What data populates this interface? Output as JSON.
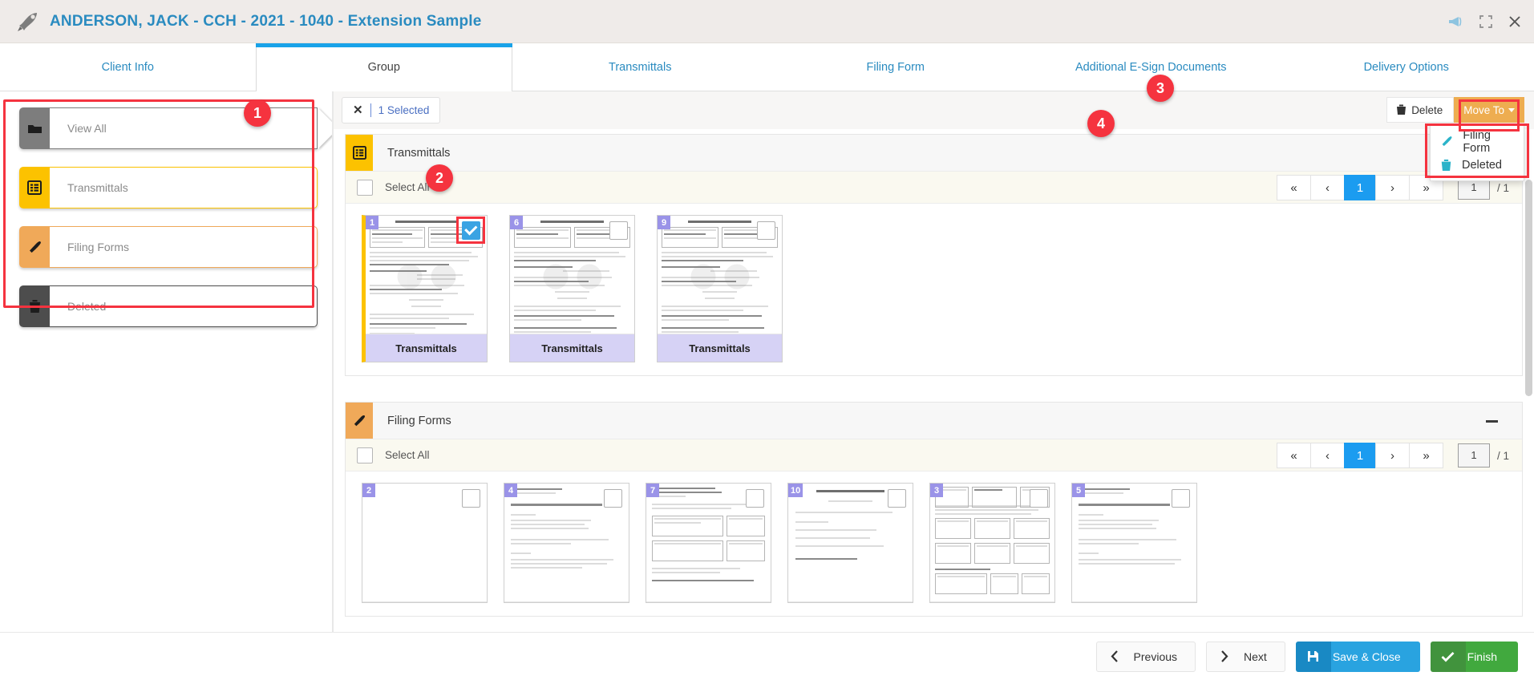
{
  "titlebar": {
    "title": "ANDERSON, JACK - CCH - 2021 - 1040 - Extension Sample",
    "icons": [
      "rocket-icon",
      "announcement-icon",
      "fullscreen-icon",
      "close-icon"
    ]
  },
  "tabs": [
    {
      "label": "Client Info",
      "active": false
    },
    {
      "label": "Group",
      "active": true
    },
    {
      "label": "Transmittals",
      "active": false
    },
    {
      "label": "Filing Form",
      "active": false
    },
    {
      "label": "Additional E-Sign Documents",
      "active": false
    },
    {
      "label": "Delivery Options",
      "active": false
    }
  ],
  "sidebar": {
    "items": [
      {
        "label": "View All",
        "icon": "folder-icon",
        "color": "#7d7d7d",
        "style": "grey"
      },
      {
        "label": "Transmittals",
        "icon": "list-icon",
        "color": "#fcc200",
        "style": "amber"
      },
      {
        "label": "Filing Forms",
        "icon": "pen-nib-icon",
        "color": "#f0a959",
        "style": "orange"
      },
      {
        "label": "Deleted",
        "icon": "trash-icon",
        "color": "#4d4d4d",
        "style": "dark"
      }
    ]
  },
  "toolbar": {
    "selected_label": "1 Selected",
    "clear_icon": "close-icon",
    "delete_label": "Delete",
    "delete_icon": "trash-icon",
    "moveto_label": "Move To",
    "moveto_color": "#eead50",
    "dropdown": [
      {
        "label": "Filing Form",
        "icon": "pen-nib-icon"
      },
      {
        "label": "Deleted",
        "icon": "trash-icon"
      }
    ]
  },
  "steps": [
    {
      "number": "1"
    },
    {
      "number": "2"
    },
    {
      "number": "3"
    },
    {
      "number": "4"
    }
  ],
  "groups": [
    {
      "title": "Transmittals",
      "icon": "list-icon",
      "accent": "#fcc200",
      "style": "amber",
      "select_all_label": "Select All",
      "collapsed": false,
      "show_collapse": false,
      "pager": {
        "first": "«",
        "prev": "‹",
        "page": "1",
        "next": "›",
        "last": "»",
        "input_value": "1",
        "total": "/ 1"
      },
      "thumbs": [
        {
          "badge": "1",
          "caption": "Transmittals",
          "checked": true,
          "selected": true,
          "doc": "letter"
        },
        {
          "badge": "6",
          "caption": "Transmittals",
          "checked": false,
          "selected": false,
          "doc": "letter"
        },
        {
          "badge": "9",
          "caption": "Transmittals",
          "checked": false,
          "selected": false,
          "doc": "letter"
        }
      ]
    },
    {
      "title": "Filing Forms",
      "icon": "pen-nib-icon",
      "accent": "#f0a959",
      "style": "orange",
      "select_all_label": "Select All",
      "collapsed": false,
      "show_collapse": true,
      "pager": {
        "first": "«",
        "prev": "‹",
        "page": "1",
        "next": "›",
        "last": "»",
        "input_value": "1",
        "total": "/ 1"
      },
      "thumbs": [
        {
          "badge": "2",
          "caption": "",
          "checked": false,
          "selected": false,
          "doc": "blank"
        },
        {
          "badge": "4",
          "caption": "",
          "checked": false,
          "selected": false,
          "doc": "form"
        },
        {
          "badge": "7",
          "caption": "",
          "checked": false,
          "selected": false,
          "doc": "form"
        },
        {
          "badge": "10",
          "caption": "",
          "checked": false,
          "selected": false,
          "doc": "worksheet"
        },
        {
          "badge": "3",
          "caption": "",
          "checked": false,
          "selected": false,
          "doc": "table"
        },
        {
          "badge": "5",
          "caption": "",
          "checked": false,
          "selected": false,
          "doc": "form"
        }
      ]
    }
  ],
  "footer": {
    "buttons": [
      {
        "label": "Previous",
        "icon": "chevron-left-icon",
        "style": "plain"
      },
      {
        "label": "Next",
        "icon": "chevron-right-icon",
        "style": "plain"
      },
      {
        "label": "Save & Close",
        "icon": "save-icon",
        "style": "blue",
        "color": "#29a3e0"
      },
      {
        "label": "Finish",
        "icon": "check-icon",
        "style": "green",
        "color": "#41a93e"
      }
    ]
  }
}
